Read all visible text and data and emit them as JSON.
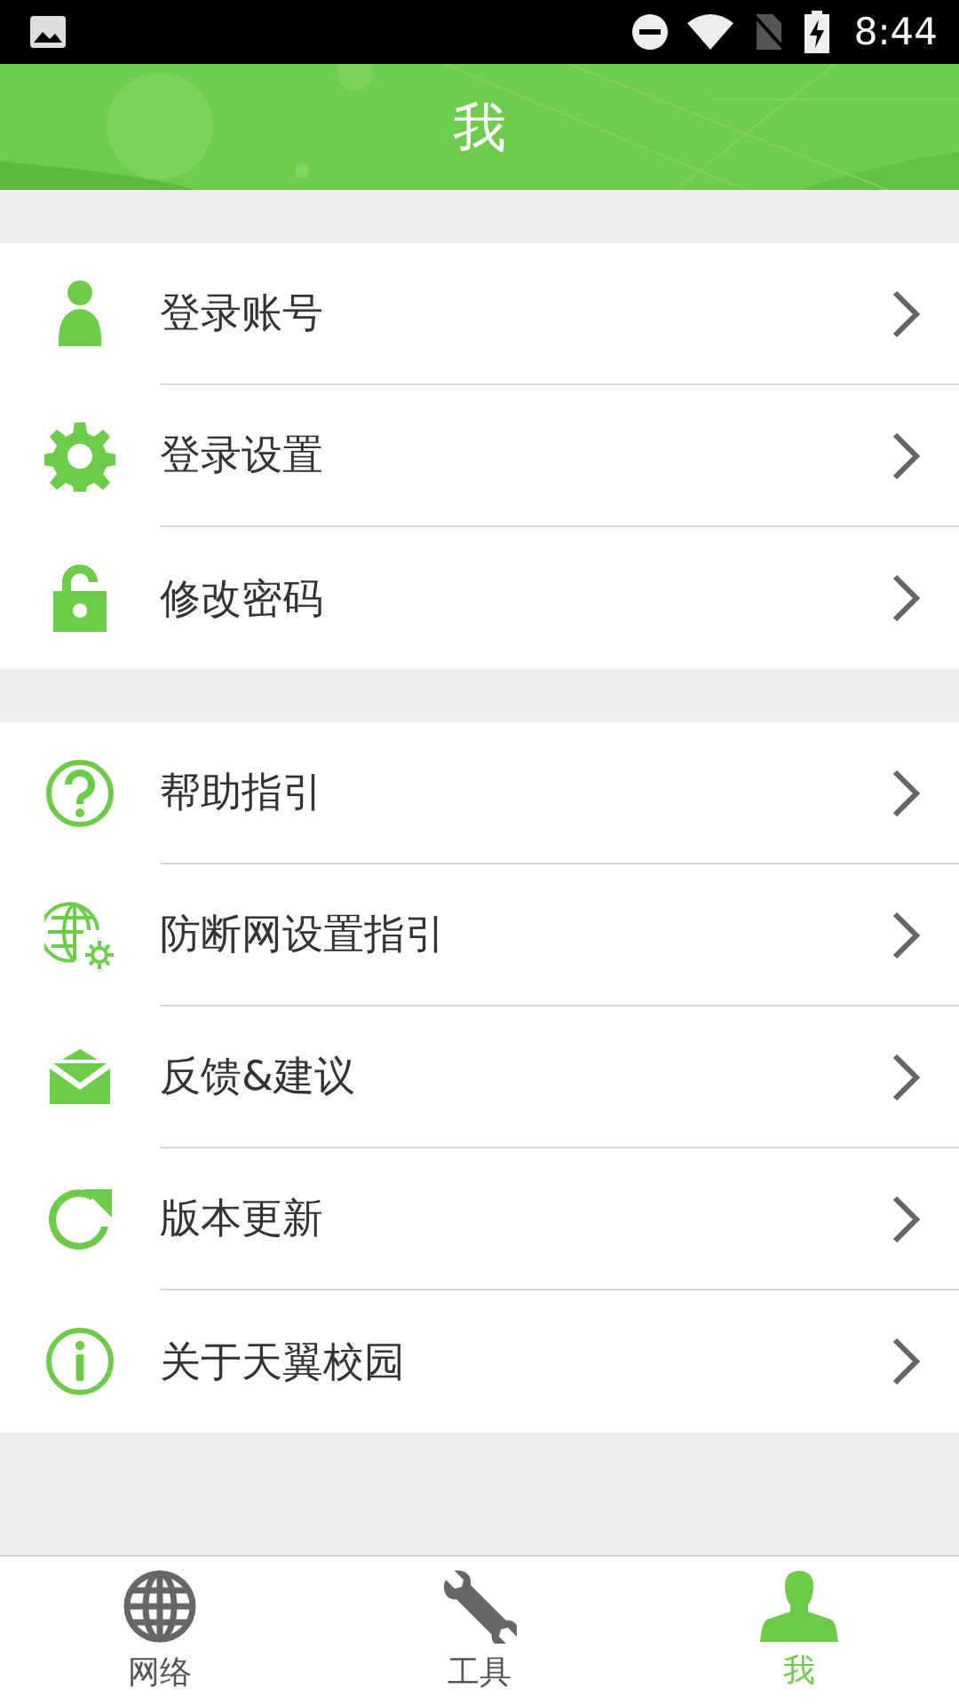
{
  "status_bar": {
    "time": "8:44"
  },
  "header": {
    "title": "我"
  },
  "groups": [
    {
      "items": [
        {
          "kind": "user",
          "label": "登录账号"
        },
        {
          "kind": "gear",
          "label": "登录设置"
        },
        {
          "kind": "unlock",
          "label": "修改密码"
        }
      ]
    },
    {
      "items": [
        {
          "kind": "help",
          "label": "帮助指引"
        },
        {
          "kind": "globe-gear",
          "label": "防断网设置指引"
        },
        {
          "kind": "mail",
          "label": "反馈&建议"
        },
        {
          "kind": "refresh",
          "label": "版本更新"
        },
        {
          "kind": "info",
          "label": "关于天翼校园"
        }
      ]
    }
  ],
  "bottom_nav": [
    {
      "kind": "globe",
      "label": "网络",
      "selected": false
    },
    {
      "kind": "wrench",
      "label": "工具",
      "selected": false
    },
    {
      "kind": "person",
      "label": "我",
      "selected": true
    }
  ]
}
